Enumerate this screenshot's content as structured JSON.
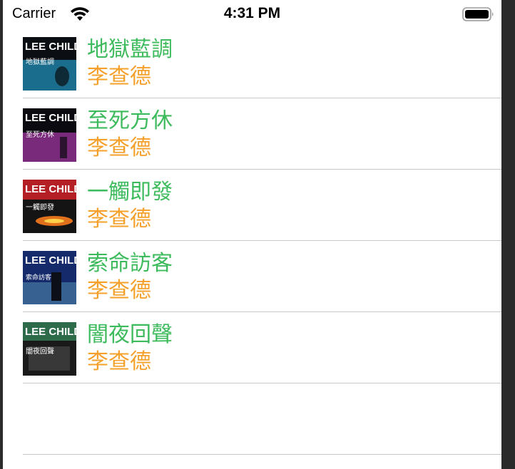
{
  "status_bar": {
    "carrier": "Carrier",
    "time": "4:31 PM",
    "wifi_icon": "wifi-icon",
    "battery_icon": "battery-icon"
  },
  "colors": {
    "title": "#3dbb5c",
    "author": "#f5a02a",
    "separator": "#c8c8cc"
  },
  "books": [
    {
      "title": "地獄藍調",
      "author": "李查德",
      "cover": {
        "brand": "LEE CHILD",
        "cover_title": "地獄藍調",
        "color": "#1a6d8c"
      }
    },
    {
      "title": "至死方休",
      "author": "李查德",
      "cover": {
        "brand": "LEE CHILD",
        "cover_title": "至死方休",
        "color": "#7a2a7a"
      }
    },
    {
      "title": "一觸即發",
      "author": "李查德",
      "cover": {
        "brand": "LEE CHILD",
        "cover_title": "一觸即發",
        "color": "#b31f24"
      }
    },
    {
      "title": "索命訪客",
      "author": "李查德",
      "cover": {
        "brand": "LEE CHILD",
        "cover_title": "索命訪客",
        "color": "#142a6b"
      }
    },
    {
      "title": "闇夜回聲",
      "author": "李查德",
      "cover": {
        "brand": "LEE CHILD",
        "cover_title": "闇夜回聲",
        "color": "#2d6b4a"
      }
    }
  ]
}
